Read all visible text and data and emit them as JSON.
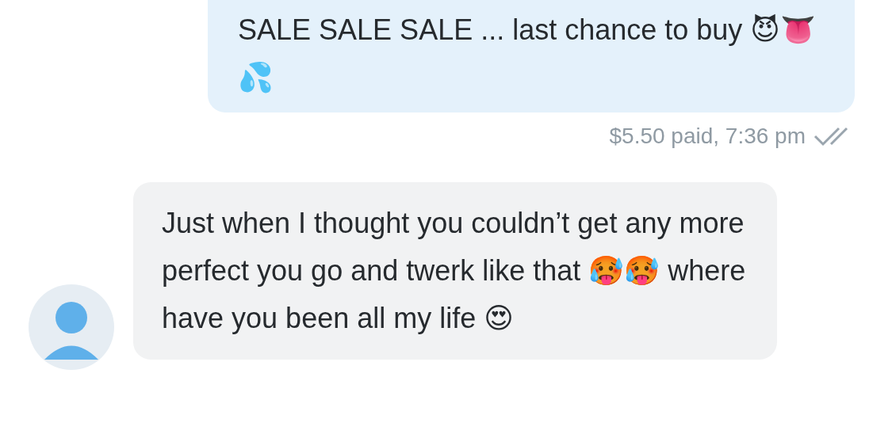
{
  "messages": [
    {
      "kind": "sent",
      "text": "SALE SALE SALE ... last chance to buy 😈👅💦",
      "meta": "$5.50 paid, 7:36 pm",
      "read": true
    },
    {
      "kind": "received",
      "text": "Just when I thought you couldn’t get any more perfect you go and twerk like that 🥵🥵 where have you been all my life 😍"
    }
  ]
}
